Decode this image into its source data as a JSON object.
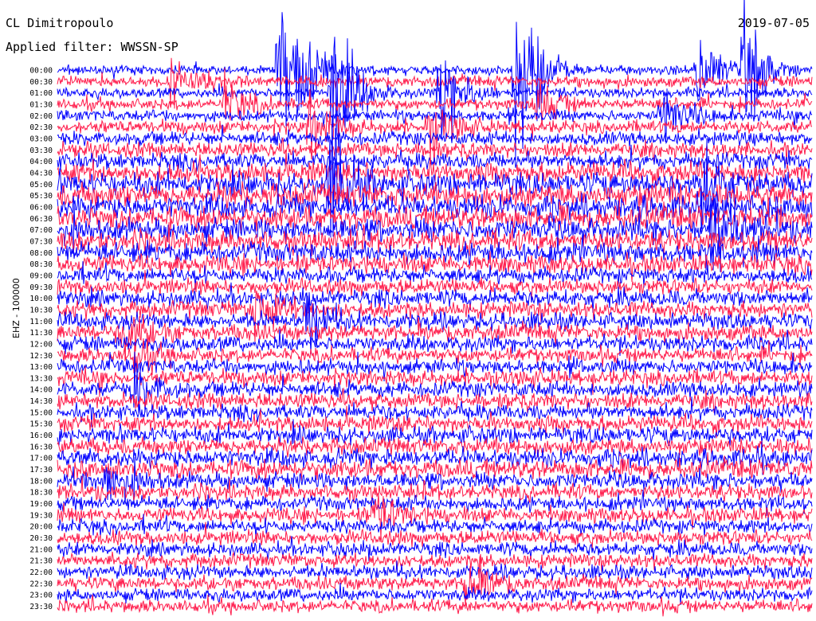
{
  "header": {
    "station": "CL Dimitropoulo",
    "filter": "Applied filter: WWSSN-SP",
    "date": "2019-07-05"
  },
  "side_label": "EHZ - 100000",
  "colors": {
    "trace_a": "#0000ff",
    "trace_b": "#ff1a4a",
    "background": "#ffffff"
  },
  "chart_data": {
    "type": "line",
    "description_kind": "helicorder",
    "row_labels": [
      "00:00",
      "00:30",
      "01:00",
      "01:30",
      "02:00",
      "02:30",
      "03:00",
      "03:30",
      "04:00",
      "04:30",
      "05:00",
      "05:30",
      "06:00",
      "06:30",
      "07:00",
      "07:30",
      "08:00",
      "08:30",
      "09:00",
      "09:30",
      "10:00",
      "10:30",
      "11:00",
      "11:30",
      "12:00",
      "12:30",
      "13:00",
      "13:30",
      "14:00",
      "14:30",
      "15:00",
      "15:30",
      "16:00",
      "16:30",
      "17:00",
      "17:30",
      "18:00",
      "18:30",
      "19:00",
      "19:30",
      "20:00",
      "20:30",
      "21:00",
      "21:30",
      "22:00",
      "22:30",
      "23:00",
      "23:30"
    ],
    "series_colors": [
      "#0000ff",
      "#ff1a4a"
    ],
    "row_noise_level": [
      0.2,
      0.3,
      0.25,
      0.3,
      0.3,
      0.4,
      0.45,
      0.5,
      0.6,
      0.8,
      0.95,
      1.0,
      1.0,
      1.0,
      0.95,
      0.9,
      0.85,
      0.7,
      0.55,
      0.5,
      0.6,
      0.6,
      0.6,
      0.6,
      0.55,
      0.5,
      0.5,
      0.55,
      0.55,
      0.55,
      0.55,
      0.55,
      0.6,
      0.6,
      0.7,
      0.75,
      0.6,
      0.55,
      0.5,
      0.5,
      0.45,
      0.45,
      0.45,
      0.45,
      0.45,
      0.45,
      0.4,
      0.4
    ],
    "events": [
      {
        "row": 0,
        "minute": 8.8,
        "amplitude": 6.0
      },
      {
        "row": 0,
        "minute": 9.5,
        "amplitude": 3.0
      },
      {
        "row": 0,
        "minute": 18.2,
        "amplitude": 9.0
      },
      {
        "row": 0,
        "minute": 25.4,
        "amplitude": 4.0
      },
      {
        "row": 0,
        "minute": 27.3,
        "amplitude": 4.5
      },
      {
        "row": 1,
        "minute": 4.5,
        "amplitude": 2.2
      },
      {
        "row": 2,
        "minute": 10.9,
        "amplitude": 7.0
      },
      {
        "row": 2,
        "minute": 15.2,
        "amplitude": 4.5
      },
      {
        "row": 3,
        "minute": 6.6,
        "amplitude": 2.5
      },
      {
        "row": 3,
        "minute": 19.0,
        "amplitude": 2.0
      },
      {
        "row": 4,
        "minute": 24.0,
        "amplitude": 3.0
      },
      {
        "row": 5,
        "minute": 10.0,
        "amplitude": 2.5
      },
      {
        "row": 5,
        "minute": 14.8,
        "amplitude": 2.0
      },
      {
        "row": 10,
        "minute": 10.8,
        "amplitude": 5.0
      },
      {
        "row": 10,
        "minute": 25.6,
        "amplitude": 3.0
      },
      {
        "row": 14,
        "minute": 26.0,
        "amplitude": 4.0
      },
      {
        "row": 21,
        "minute": 7.8,
        "amplitude": 2.5
      },
      {
        "row": 22,
        "minute": 9.8,
        "amplitude": 2.5
      },
      {
        "row": 23,
        "minute": 2.5,
        "amplitude": 2.5
      },
      {
        "row": 25,
        "minute": 3.0,
        "amplitude": 1.5
      },
      {
        "row": 28,
        "minute": 3.0,
        "amplitude": 2.0
      },
      {
        "row": 36,
        "minute": 1.8,
        "amplitude": 2.0
      },
      {
        "row": 39,
        "minute": 12.6,
        "amplitude": 2.0
      },
      {
        "row": 45,
        "minute": 16.2,
        "amplitude": 3.0
      }
    ]
  }
}
